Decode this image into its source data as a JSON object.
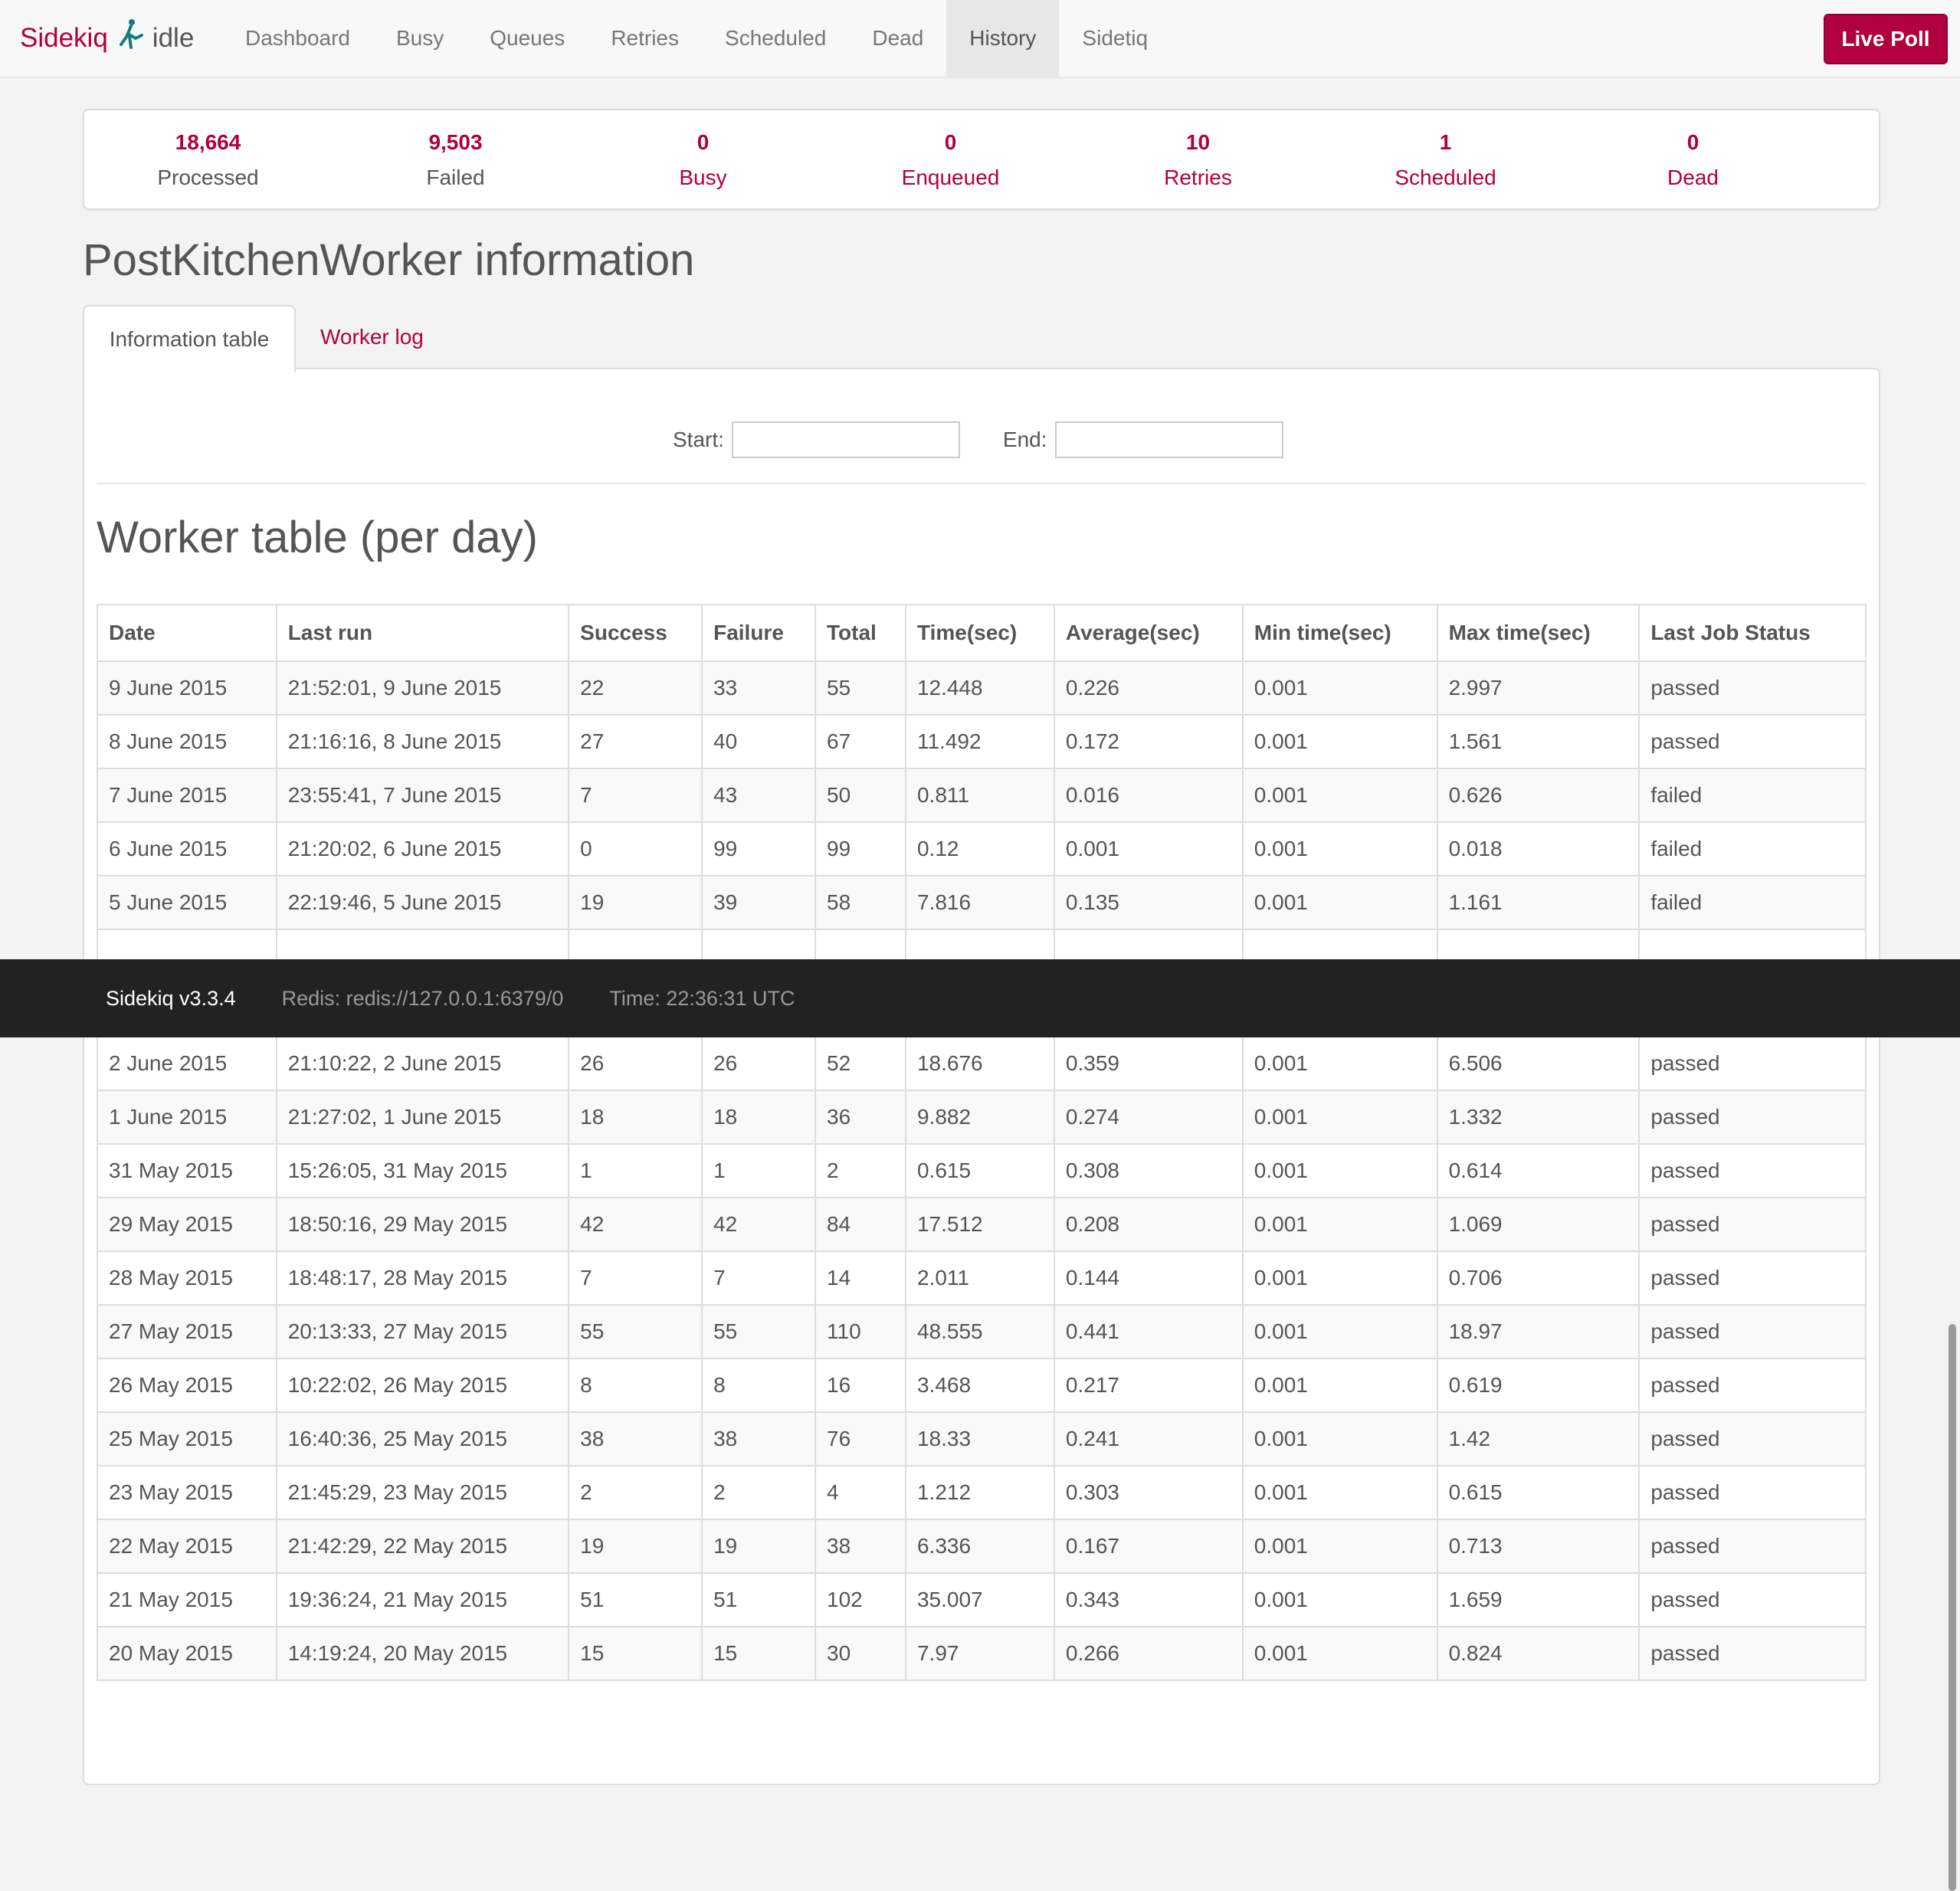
{
  "navbar": {
    "brand": "Sidekiq",
    "status": "idle",
    "items": [
      "Dashboard",
      "Busy",
      "Queues",
      "Retries",
      "Scheduled",
      "Dead",
      "History",
      "Sidetiq"
    ],
    "active_item": "History",
    "live_poll": "Live Poll",
    "brand_color": "#b1003e"
  },
  "summary": [
    {
      "count": "18,664",
      "label": "Processed"
    },
    {
      "count": "9,503",
      "label": "Failed"
    },
    {
      "count": "0",
      "label": "Busy"
    },
    {
      "count": "0",
      "label": "Enqueued"
    },
    {
      "count": "10",
      "label": "Retries"
    },
    {
      "count": "1",
      "label": "Scheduled"
    },
    {
      "count": "0",
      "label": "Dead"
    }
  ],
  "page_title": "PostKitchenWorker information",
  "tabs": [
    "Information table",
    "Worker log"
  ],
  "filter": {
    "start_label": "Start:",
    "end_label": "End:",
    "start_value": "",
    "end_value": ""
  },
  "table": {
    "title": "Worker table (per day)",
    "headers": [
      "Date",
      "Last run",
      "Success",
      "Failure",
      "Total",
      "Time(sec)",
      "Average(sec)",
      "Min time(sec)",
      "Max time(sec)",
      "Last Job Status"
    ],
    "rows": [
      [
        "9 June 2015",
        "21:52:01, 9 June 2015",
        "22",
        "33",
        "55",
        "12.448",
        "0.226",
        "0.001",
        "2.997",
        "passed"
      ],
      [
        "8 June 2015",
        "21:16:16, 8 June 2015",
        "27",
        "40",
        "67",
        "11.492",
        "0.172",
        "0.001",
        "1.561",
        "passed"
      ],
      [
        "7 June 2015",
        "23:55:41, 7 June 2015",
        "7",
        "43",
        "50",
        "0.811",
        "0.016",
        "0.001",
        "0.626",
        "failed"
      ],
      [
        "6 June 2015",
        "21:20:02, 6 June 2015",
        "0",
        "99",
        "99",
        "0.12",
        "0.001",
        "0.001",
        "0.018",
        "failed"
      ],
      [
        "5 June 2015",
        "22:19:46, 5 June 2015",
        "19",
        "39",
        "58",
        "7.816",
        "0.135",
        "0.001",
        "1.161",
        "failed"
      ],
      [
        "",
        "",
        "",
        "",
        "",
        "",
        "",
        "",
        "",
        ""
      ],
      [
        "",
        "",
        "",
        "",
        "",
        "",
        "",
        "",
        "",
        ""
      ],
      [
        "2 June 2015",
        "21:10:22, 2 June 2015",
        "26",
        "26",
        "52",
        "18.676",
        "0.359",
        "0.001",
        "6.506",
        "passed"
      ],
      [
        "1 June 2015",
        "21:27:02, 1 June 2015",
        "18",
        "18",
        "36",
        "9.882",
        "0.274",
        "0.001",
        "1.332",
        "passed"
      ],
      [
        "31 May 2015",
        "15:26:05, 31 May 2015",
        "1",
        "1",
        "2",
        "0.615",
        "0.308",
        "0.001",
        "0.614",
        "passed"
      ],
      [
        "29 May 2015",
        "18:50:16, 29 May 2015",
        "42",
        "42",
        "84",
        "17.512",
        "0.208",
        "0.001",
        "1.069",
        "passed"
      ],
      [
        "28 May 2015",
        "18:48:17, 28 May 2015",
        "7",
        "7",
        "14",
        "2.011",
        "0.144",
        "0.001",
        "0.706",
        "passed"
      ],
      [
        "27 May 2015",
        "20:13:33, 27 May 2015",
        "55",
        "55",
        "110",
        "48.555",
        "0.441",
        "0.001",
        "18.97",
        "passed"
      ],
      [
        "26 May 2015",
        "10:22:02, 26 May 2015",
        "8",
        "8",
        "16",
        "3.468",
        "0.217",
        "0.001",
        "0.619",
        "passed"
      ],
      [
        "25 May 2015",
        "16:40:36, 25 May 2015",
        "38",
        "38",
        "76",
        "18.33",
        "0.241",
        "0.001",
        "1.42",
        "passed"
      ],
      [
        "23 May 2015",
        "21:45:29, 23 May 2015",
        "2",
        "2",
        "4",
        "1.212",
        "0.303",
        "0.001",
        "0.615",
        "passed"
      ],
      [
        "22 May 2015",
        "21:42:29, 22 May 2015",
        "19",
        "19",
        "38",
        "6.336",
        "0.167",
        "0.001",
        "0.713",
        "passed"
      ],
      [
        "21 May 2015",
        "19:36:24, 21 May 2015",
        "51",
        "51",
        "102",
        "35.007",
        "0.343",
        "0.001",
        "1.659",
        "passed"
      ],
      [
        "20 May 2015",
        "14:19:24, 20 May 2015",
        "15",
        "15",
        "30",
        "7.97",
        "0.266",
        "0.001",
        "0.824",
        "passed"
      ]
    ]
  },
  "footer": {
    "version": "Sidekiq v3.3.4",
    "redis": "Redis: redis://127.0.0.1:6379/0",
    "time": "Time: 22:36:31 UTC"
  }
}
